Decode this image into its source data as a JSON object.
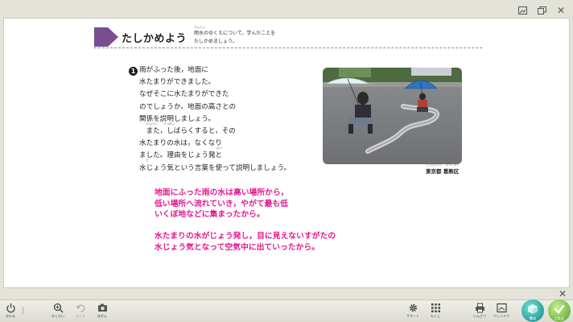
{
  "window": {
    "close_icon": "✕"
  },
  "header": {
    "title": "たしかめよう",
    "goal_ruby": "ちゅうい",
    "goal_line1": "雨水のゆくえについて，学んだことを",
    "goal_line2": "たしかめましょう。"
  },
  "question": {
    "number": "1",
    "text": "雨がふった後，地面に\n水たまりができました。\nなぜそこに水たまりができた\nのでしょうか。地面の高さとの\n関係を説明しましょう。\n　また，しばらくすると，その\n水たまりの水は，なくなり\nました。理由をじょう発と\n水じょう気という言葉を使って説明しましょう。",
    "ruby_kankei": "かんけい",
    "ruby_setsumei": "せつめい",
    "ruby_hatsu": "はつ",
    "ruby_ki": "き"
  },
  "photo": {
    "caption": "東京都 葛飾区",
    "caption_ruby": "とうきょうと　かつしかく"
  },
  "answers": {
    "a1": "地面にふった雨の水は高い場所から，\n低い場所へ流れていき，やがて最も低\nいくぼ地などに集まったから。",
    "a2": "水たまりの水がじょう発し，目に見えないすがたの\n水じょう気となって空気中に出ていったから。"
  },
  "toolbar": {
    "end": "おわる",
    "zoom": "かくだい",
    "undo": "もどす",
    "capture": "ほぞん",
    "support": "サポート",
    "menu": "もくじ",
    "print": "いんさつ",
    "window": "ウィンドウ",
    "study": "学ぶ",
    "answer": "こたえ"
  },
  "colors": {
    "accent_purple": "#7a4d92",
    "answer_pink": "#e4188f"
  }
}
